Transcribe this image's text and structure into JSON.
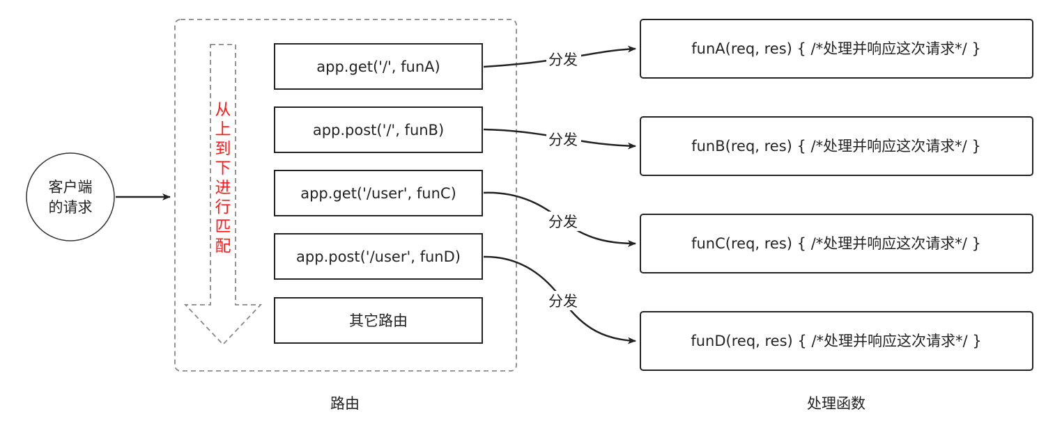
{
  "client": {
    "line1": "客户端",
    "line2": "的请求"
  },
  "route_order_label": [
    "从",
    "上",
    "到",
    "下",
    "进",
    "行",
    "匹",
    "配"
  ],
  "routes": [
    {
      "label": "app.get('/', funA)"
    },
    {
      "label": "app.post('/', funB)"
    },
    {
      "label": "app.get('/user', funC)"
    },
    {
      "label": "app.post('/user', funD)"
    },
    {
      "label": "其它路由"
    }
  ],
  "dispatch_label": "分发",
  "handlers": [
    {
      "label": "funA(req, res) { /*处理并响应这次请求*/ }"
    },
    {
      "label": "funB(req, res) { /*处理并响应这次请求*/ }"
    },
    {
      "label": "funC(req, res) { /*处理并响应这次请求*/ }"
    },
    {
      "label": "funD(req, res) { /*处理并响应这次请求*/ }"
    }
  ],
  "captions": {
    "routes": "路由",
    "handlers": "处理函数"
  },
  "colors": {
    "stroke": "#222222",
    "dashed": "#888888",
    "accent_text": "#ff1a1a"
  }
}
